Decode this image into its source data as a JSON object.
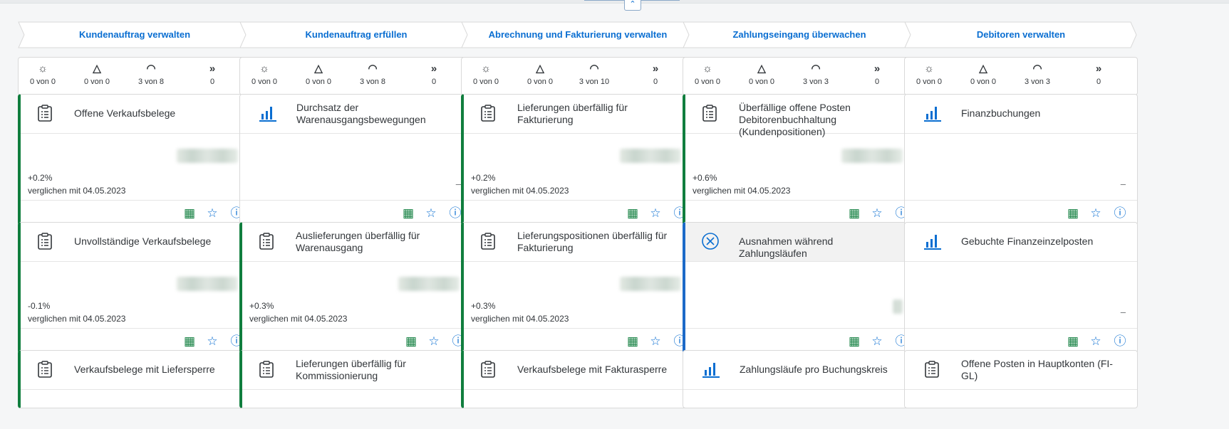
{
  "colors": {
    "accent": "#0a6ed1",
    "status_green": "#107e3e",
    "status_blue": "#1c6ac8",
    "table_icon": "#107e3e"
  },
  "kpi_icons": [
    "sun-alert-icon",
    "triangle-icon",
    "gauge-icon",
    "forward-icon"
  ],
  "tile_actions": [
    "table-icon",
    "star-icon",
    "info-icon"
  ],
  "columns": [
    {
      "phase": "Kundenauftrag verwalten",
      "kpis": [
        "0 von 0",
        "0 von 0",
        "3 von 8",
        "0"
      ],
      "tiles": [
        {
          "title": "Offene Verkaufsbelege",
          "icon": "clipboard-icon",
          "status": "green",
          "value_blurred": true,
          "trend_icon": "trend-up-icon",
          "change": "+0.2%",
          "comparison": "verglichen mit 04.05.2023"
        },
        {
          "title": "Unvollständige Verkaufsbelege",
          "icon": "clipboard-icon",
          "status": "green",
          "value_blurred": true,
          "trend_icon": "trend-down-icon",
          "change": "-0.1%",
          "comparison": "verglichen mit 04.05.2023"
        },
        {
          "title": "Verkaufsbelege mit Liefersperre",
          "icon": "clipboard-icon",
          "status": "green"
        }
      ]
    },
    {
      "phase": "Kundenauftrag erfüllen",
      "kpis": [
        "0 von 0",
        "0 von 0",
        "3 von 8",
        "0"
      ],
      "tiles": [
        {
          "title": "Durchsatz der Warenausgangsbewegungen",
          "icon": "bar-chart-icon",
          "status": "none",
          "dash": "–"
        },
        {
          "title": "Auslieferungen überfällig für Warenausgang",
          "icon": "clipboard-icon",
          "status": "green",
          "value_blurred": true,
          "trend_icon": "trend-up-icon",
          "change": "+0.3%",
          "comparison": "verglichen mit 04.05.2023"
        },
        {
          "title": "Lieferungen überfällig für Kommissionierung",
          "icon": "clipboard-icon",
          "status": "green"
        }
      ]
    },
    {
      "phase": "Abrechnung und Fakturierung verwalten",
      "kpis": [
        "0 von 0",
        "0 von 0",
        "3 von 10",
        "0"
      ],
      "tiles": [
        {
          "title": "Lieferungen überfällig für Fakturierung",
          "icon": "clipboard-icon",
          "status": "green",
          "value_blurred": true,
          "trend_icon": "trend-up-icon",
          "change": "+0.2%",
          "comparison": "verglichen mit 04.05.2023"
        },
        {
          "title": "Lieferungspositionen überfällig für Fakturierung",
          "icon": "clipboard-icon",
          "status": "green",
          "value_blurred": true,
          "trend_icon": "trend-up-icon",
          "change": "+0.3%",
          "comparison": "verglichen mit 04.05.2023"
        },
        {
          "title": "Verkaufsbelege mit Fakturasperre",
          "icon": "clipboard-icon",
          "status": "green"
        }
      ]
    },
    {
      "phase": "Zahlungseingang überwachen",
      "kpis": [
        "0 von 0",
        "0 von 0",
        "3 von 3",
        "0"
      ],
      "tiles": [
        {
          "title": "Überfällige offene Posten Debitorenbuchhaltung (Kundenpositionen)",
          "icon": "clipboard-icon",
          "status": "green",
          "value_blurred": true,
          "trend_icon": "trend-up-icon",
          "change": "+0.6%",
          "comparison": "verglichen mit 04.05.2023"
        },
        {
          "title": "Ausnahmen während Zahlungsläufen",
          "icon": "error-circle-icon",
          "status": "blue",
          "value_blurred": true,
          "small_value": true
        },
        {
          "title": "Zahlungsläufe pro Buchungskreis",
          "icon": "bar-chart-icon",
          "status": "none"
        }
      ]
    },
    {
      "phase": "Debitoren verwalten",
      "kpis": [
        "0 von 0",
        "0 von 0",
        "3 von 3",
        "0"
      ],
      "tiles": [
        {
          "title": "Finanzbuchungen",
          "icon": "bar-chart-icon",
          "status": "none",
          "dash": "–"
        },
        {
          "title": "Gebuchte Finanzeinzelposten",
          "icon": "bar-chart-icon",
          "status": "none",
          "dash": "–"
        },
        {
          "title": "Offene Posten in Hauptkonten (FI-GL)",
          "icon": "clipboard-icon",
          "status": "none"
        }
      ]
    }
  ]
}
